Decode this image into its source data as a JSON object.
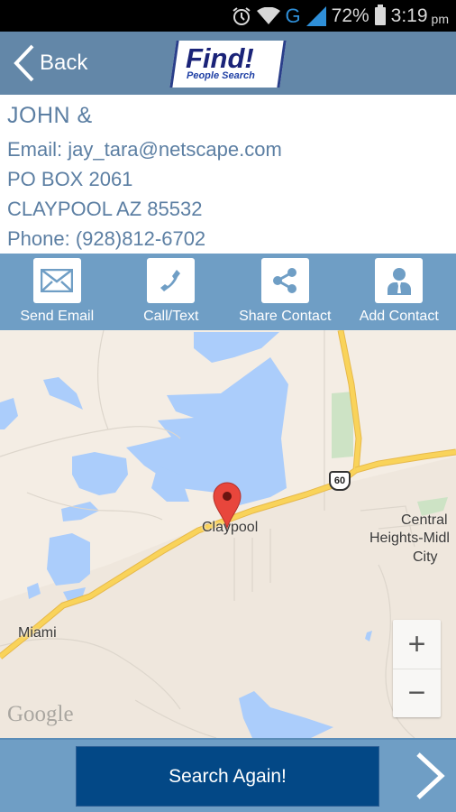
{
  "status_bar": {
    "icons": [
      "alarm-icon",
      "wifi-icon",
      "network-type-icon",
      "signal-icon",
      "battery-icon"
    ],
    "network_type": "G",
    "battery": "72%",
    "time": "3:19",
    "ampm": "pm"
  },
  "header": {
    "back_label": "Back",
    "logo_title": "Find!",
    "logo_subtitle": "People Search"
  },
  "contact": {
    "name": "JOHN &",
    "email": "Email: jay_tara@netscape.com",
    "address_line1": "PO BOX 2061",
    "address_line2": "CLAYPOOL AZ 85532",
    "phone": "Phone: (928)812-6702"
  },
  "actions": [
    {
      "label": "Send Email",
      "icon": "envelope-icon"
    },
    {
      "label": "Call/Text",
      "icon": "phone-icon"
    },
    {
      "label": "Share Contact",
      "icon": "share-icon"
    },
    {
      "label": "Add Contact",
      "icon": "person-icon"
    }
  ],
  "map": {
    "labels": {
      "claypool": "Claypool",
      "central": "Central",
      "heights": "Heights-Midl",
      "city": "City",
      "miami": "Miami"
    },
    "highway_shield": "60",
    "zoom_in": "+",
    "zoom_out": "−",
    "attribution": "Google",
    "colors": {
      "land": "#f4ede4",
      "water": "#abcdfb",
      "highway": "#f9d35a",
      "park": "#cde3c5",
      "marker": "#e8463c"
    }
  },
  "footer": {
    "search_again_label": "Search Again!",
    "next_icon": "chevron-right-icon"
  }
}
